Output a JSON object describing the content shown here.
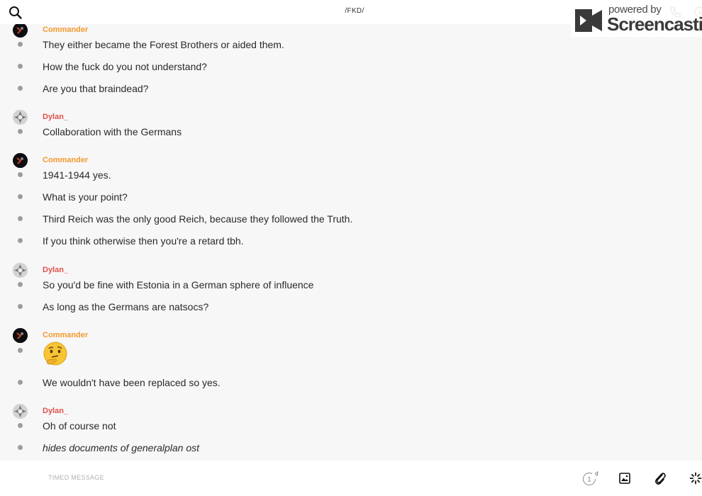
{
  "header": {
    "title": "/FKD/",
    "search_icon": "search-icon",
    "call_icon": "phone-icon",
    "info_icon": "info-icon"
  },
  "watermark": {
    "powered_text": "powered by",
    "brand_text": "Screencastify"
  },
  "colors": {
    "commander_name": "#f39a2d",
    "dylan_name": "#e0524a",
    "bullet": "#9c9c9c",
    "background": "#f7f7f8"
  },
  "messages": [
    {
      "sender": "Commander",
      "lines": [
        "They either became the Forest Brothers or aided them.",
        "How the fuck do you not understand?",
        "Are you that braindead?"
      ]
    },
    {
      "sender": "Dylan_",
      "lines": [
        "Collaboration with the Germans"
      ]
    },
    {
      "sender": "Commander",
      "lines": [
        "1941-1944 yes.",
        "What is your point?",
        "Third Reich was the only good Reich, because they followed the Truth.",
        "If you think otherwise then you're a retard tbh."
      ]
    },
    {
      "sender": "Dylan_",
      "lines": [
        "So you'd be fine with Estonia in a German sphere of influence",
        "As long as the Germans are natsocs?"
      ]
    },
    {
      "sender": "Commander",
      "lines": [
        "thinking-face-emoji",
        "We wouldn't have been replaced so yes."
      ]
    },
    {
      "sender": "Dylan_",
      "lines": [
        "Oh of course not",
        "hides documents of generalplan ost"
      ]
    }
  ],
  "composer": {
    "placeholder": "TIMED MESSAGE",
    "timer_value": "1",
    "timer_unit": "d",
    "image_icon": "image-icon",
    "attach_icon": "paperclip-icon",
    "sparkle_icon": "sparkle-icon"
  }
}
